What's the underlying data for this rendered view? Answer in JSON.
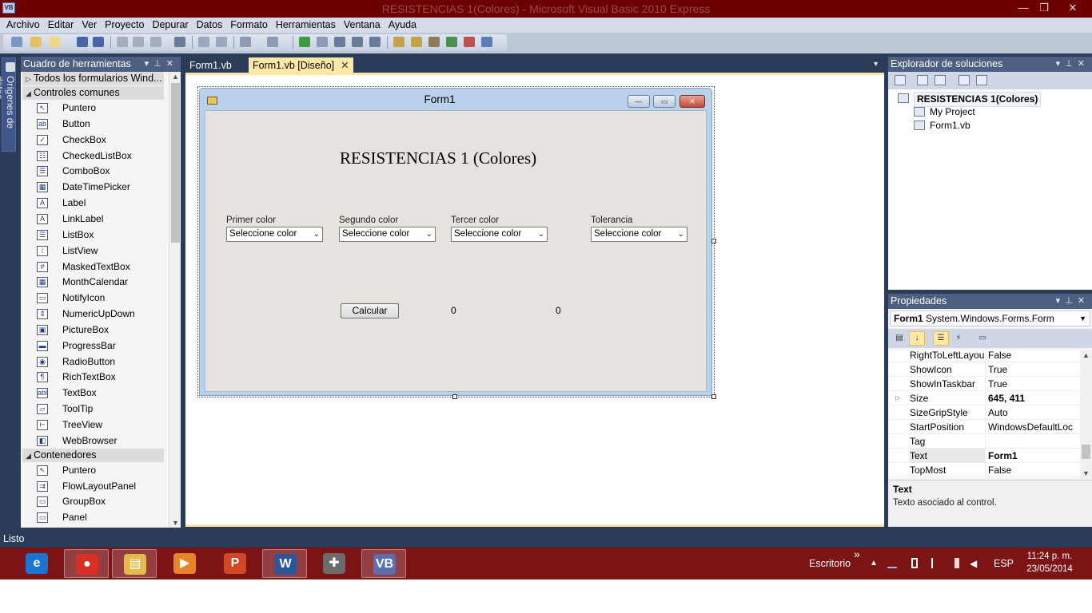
{
  "window": {
    "app_icon": "vb-icon",
    "title": "RESISTENCIAS 1(Colores) - Microsoft Visual Basic 2010 Express",
    "minimize": "—",
    "restore": "❐",
    "close": "✕"
  },
  "menu": [
    "Archivo",
    "Editar",
    "Ver",
    "Proyecto",
    "Depurar",
    "Datos",
    "Formato",
    "Herramientas",
    "Ventana",
    "Ayuda"
  ],
  "side_tab": {
    "label": "Orígenes de datos"
  },
  "toolbox": {
    "title": "Cuadro de herramientas",
    "categories": {
      "all_forms": "Todos los formularios Wind...",
      "common": "Controles comunes",
      "containers": "Contenedores"
    },
    "common_items": [
      {
        "label": "Puntero",
        "icon": "pointer-icon",
        "glyph": "↖"
      },
      {
        "label": "Button",
        "icon": "button-icon",
        "glyph": "ab"
      },
      {
        "label": "CheckBox",
        "icon": "checkbox-icon",
        "glyph": "✓"
      },
      {
        "label": "CheckedListBox",
        "icon": "checkedlistbox-icon",
        "glyph": "☷"
      },
      {
        "label": "ComboBox",
        "icon": "combobox-icon",
        "glyph": "☰"
      },
      {
        "label": "DateTimePicker",
        "icon": "datetimepicker-icon",
        "glyph": "▦"
      },
      {
        "label": "Label",
        "icon": "label-icon",
        "glyph": "A"
      },
      {
        "label": "LinkLabel",
        "icon": "linklabel-icon",
        "glyph": "A"
      },
      {
        "label": "ListBox",
        "icon": "listbox-icon",
        "glyph": "☰"
      },
      {
        "label": "ListView",
        "icon": "listview-icon",
        "glyph": "⁞"
      },
      {
        "label": "MaskedTextBox",
        "icon": "maskedtextbox-icon",
        "glyph": "#"
      },
      {
        "label": "MonthCalendar",
        "icon": "monthcalendar-icon",
        "glyph": "▦"
      },
      {
        "label": "NotifyIcon",
        "icon": "notifyicon-icon",
        "glyph": "▭"
      },
      {
        "label": "NumericUpDown",
        "icon": "numericupdown-icon",
        "glyph": "⇕"
      },
      {
        "label": "PictureBox",
        "icon": "picturebox-icon",
        "glyph": "▣"
      },
      {
        "label": "ProgressBar",
        "icon": "progressbar-icon",
        "glyph": "▬"
      },
      {
        "label": "RadioButton",
        "icon": "radiobutton-icon",
        "glyph": "◉"
      },
      {
        "label": "RichTextBox",
        "icon": "richtextbox-icon",
        "glyph": "¶"
      },
      {
        "label": "TextBox",
        "icon": "textbox-icon",
        "glyph": "abl"
      },
      {
        "label": "ToolTip",
        "icon": "tooltip-icon",
        "glyph": "▱"
      },
      {
        "label": "TreeView",
        "icon": "treeview-icon",
        "glyph": "⊢"
      },
      {
        "label": "WebBrowser",
        "icon": "webbrowser-icon",
        "glyph": "◧"
      }
    ],
    "container_items": [
      {
        "label": "Puntero",
        "icon": "pointer-icon",
        "glyph": "↖"
      },
      {
        "label": "FlowLayoutPanel",
        "icon": "flowlayoutpanel-icon",
        "glyph": "⇉"
      },
      {
        "label": "GroupBox",
        "icon": "groupbox-icon",
        "glyph": "▭"
      },
      {
        "label": "Panel",
        "icon": "panel-icon",
        "glyph": "▭"
      }
    ]
  },
  "tabs": [
    {
      "label": "Form1.vb",
      "active": false
    },
    {
      "label": "Form1.vb [Diseño]",
      "active": true
    }
  ],
  "designer": {
    "form_title": "Form1",
    "heading": "RESISTENCIAS 1 (Colores)",
    "fields": [
      {
        "label": "Primer color",
        "combo": "Seleccione color"
      },
      {
        "label": "Segundo color",
        "combo": "Seleccione color"
      },
      {
        "label": "Tercer color",
        "combo": "Seleccione color"
      },
      {
        "label": "Tolerancia",
        "combo": "Seleccione color"
      }
    ],
    "button": "Calcular",
    "output1": "0",
    "output2": "0"
  },
  "solution_explorer": {
    "title": "Explorador de soluciones",
    "nodes": [
      "RESISTENCIAS 1(Colores)",
      "My Project",
      "Form1.vb"
    ]
  },
  "properties": {
    "title": "Propiedades",
    "object_name": "Form1",
    "object_type": "System.Windows.Forms.Form",
    "rows": [
      {
        "name": "RightToLeftLayou",
        "value": "False",
        "bold": false,
        "expandable": false
      },
      {
        "name": "ShowIcon",
        "value": "True",
        "bold": false,
        "expandable": false
      },
      {
        "name": "ShowInTaskbar",
        "value": "True",
        "bold": false,
        "expandable": false
      },
      {
        "name": "Size",
        "value": "645, 411",
        "bold": true,
        "expandable": true
      },
      {
        "name": "SizeGripStyle",
        "value": "Auto",
        "bold": false,
        "expandable": false
      },
      {
        "name": "StartPosition",
        "value": "WindowsDefaultLoc",
        "bold": false,
        "expandable": false
      },
      {
        "name": "Tag",
        "value": "",
        "bold": false,
        "expandable": false
      },
      {
        "name": "Text",
        "value": "Form1",
        "bold": true,
        "expandable": false
      },
      {
        "name": "TopMost",
        "value": "False",
        "bold": false,
        "expandable": false
      }
    ],
    "desc_title": "Text",
    "desc_text": "Texto asociado al control."
  },
  "status": "Listo",
  "taskbar": {
    "apps": [
      {
        "name": "internet-explorer-icon",
        "color": "#1c73d2",
        "glyph": "e",
        "pressed": false
      },
      {
        "name": "chrome-icon",
        "color": "#d93025",
        "glyph": "●",
        "pressed": true
      },
      {
        "name": "file-explorer-icon",
        "color": "#e6b94c",
        "glyph": "▤",
        "pressed": true
      },
      {
        "name": "media-player-icon",
        "color": "#e8832a",
        "glyph": "▶",
        "pressed": false
      },
      {
        "name": "powerpoint-icon",
        "color": "#d24726",
        "glyph": "P",
        "pressed": false
      },
      {
        "name": "word-icon",
        "color": "#2b579a",
        "glyph": "W",
        "pressed": true
      },
      {
        "name": "game-app-icon",
        "color": "#6b6b6b",
        "glyph": "✚",
        "pressed": false
      },
      {
        "name": "visual-basic-icon",
        "color": "#5a6fb0",
        "glyph": "VB",
        "pressed": true
      }
    ],
    "toolbar_label": "Escritorio",
    "chevron": "»",
    "language": "ESP",
    "time": "11:24 p. m.",
    "date": "23/05/2014"
  }
}
